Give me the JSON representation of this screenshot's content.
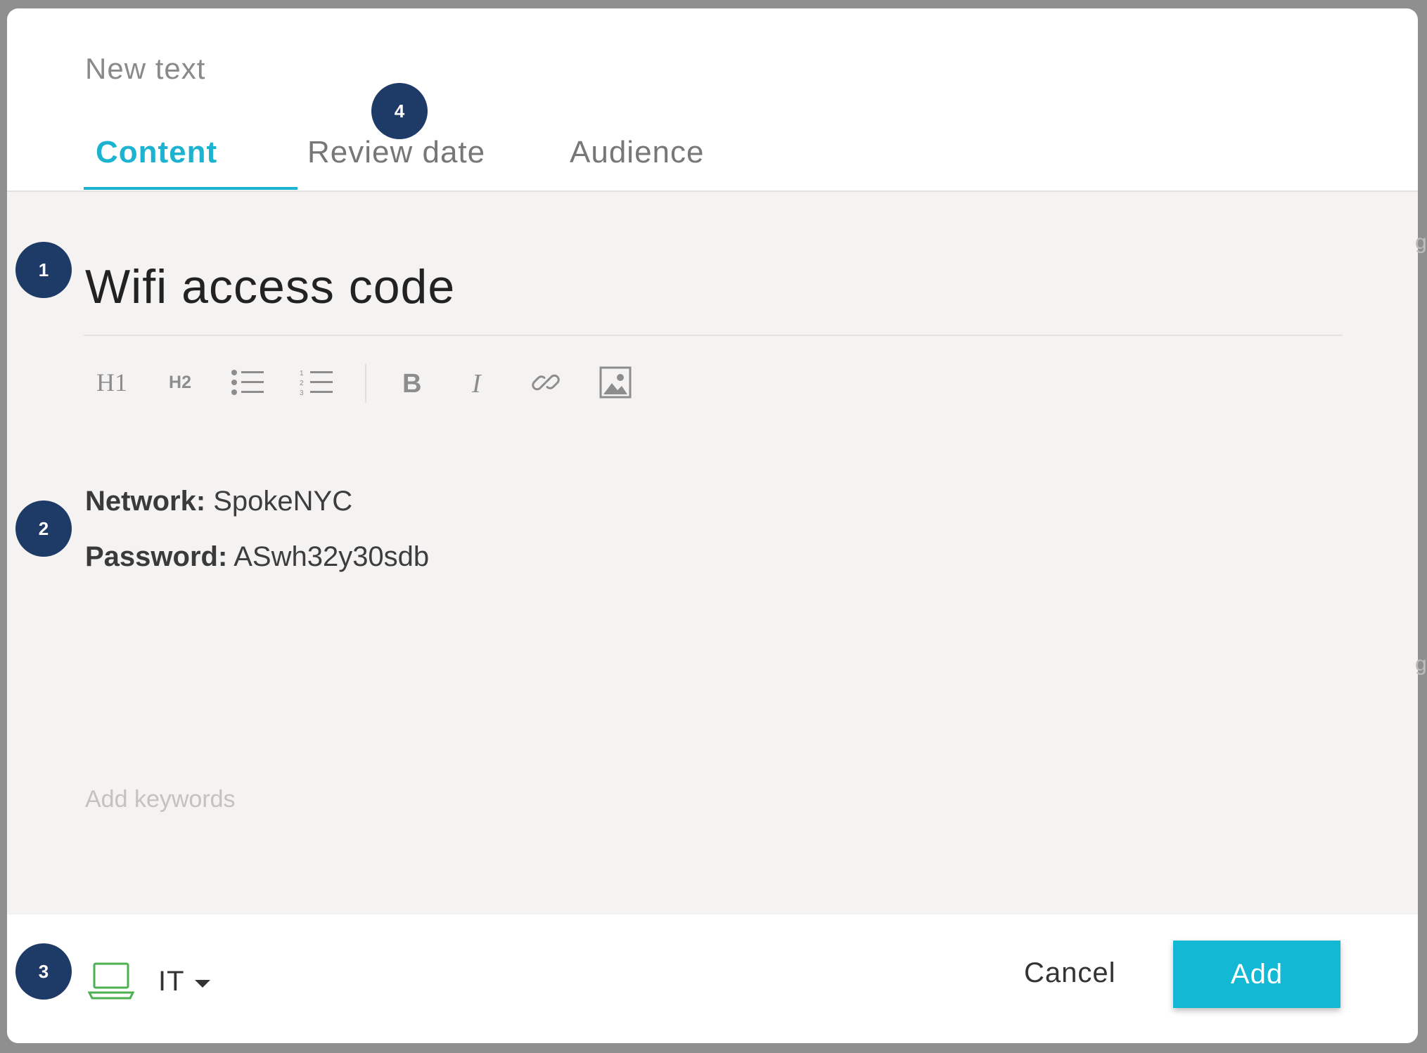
{
  "modal": {
    "title": "New text",
    "tabs": [
      {
        "label": "Content",
        "active": true
      },
      {
        "label": "Review date",
        "active": false
      },
      {
        "label": "Audience",
        "active": false
      }
    ]
  },
  "editor": {
    "title": "Wifi access code",
    "toolbar": {
      "h1_label": "H1",
      "h2_label": "H2",
      "buttons": [
        "bulleted-list-icon",
        "numbered-list-icon",
        "bold-icon",
        "italic-icon",
        "link-icon",
        "image-icon"
      ]
    },
    "body": [
      {
        "label": "Network:",
        "value": " SpokeNYC"
      },
      {
        "label": "Password:",
        "value": " ASwh32y30sdb"
      }
    ],
    "keywords_placeholder": "Add keywords"
  },
  "footer": {
    "department": "IT",
    "department_icon": "laptop-icon",
    "cancel_label": "Cancel",
    "add_label": "Add"
  },
  "markers": [
    "1",
    "2",
    "3",
    "4"
  ],
  "colors": {
    "accent": "#13b8d4",
    "marker": "#1e3a66",
    "laptop_icon": "#4caf50",
    "content_bg": "#f4f3f2"
  }
}
